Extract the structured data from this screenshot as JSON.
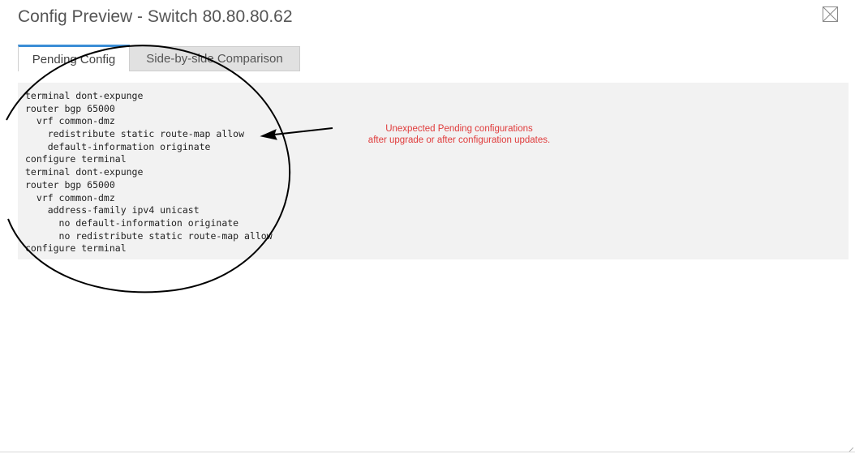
{
  "dialog": {
    "title": "Config Preview - Switch 80.80.80.62",
    "close_icon": "close-icon"
  },
  "tabs": [
    {
      "label": "Pending Config",
      "active": true
    },
    {
      "label": "Side-by-side Comparison",
      "active": false
    }
  ],
  "config_lines": [
    "terminal dont-expunge",
    "router bgp 65000",
    "  vrf common-dmz",
    "    redistribute static route-map allow",
    "    default-information originate",
    "configure terminal",
    "terminal dont-expunge",
    "router bgp 65000",
    "  vrf common-dmz",
    "    address-family ipv4 unicast",
    "      no default-information originate",
    "      no redistribute static route-map allow",
    "configure terminal"
  ],
  "annotation": {
    "line1": "Unexpected Pending configurations",
    "line2": "after upgrade or after configuration updates.",
    "color": "#e03b3b"
  },
  "colors": {
    "active_tab_accent": "#3a8dd6",
    "code_background": "#f2f2f2"
  }
}
